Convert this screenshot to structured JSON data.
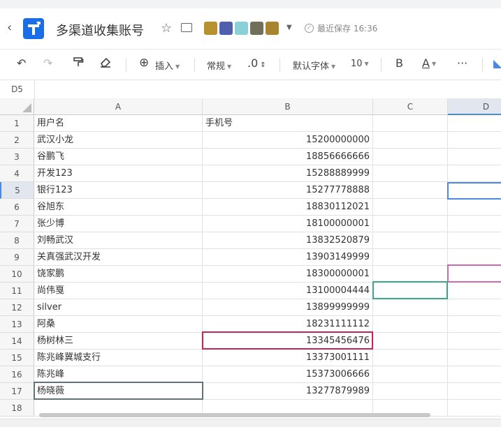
{
  "title_bar": {
    "doc_title": "多渠道收集账号",
    "save_status": "最近保存 16:36"
  },
  "toolbar": {
    "insert_label": "插入",
    "format_label": "常规",
    "decimal_label": ".0",
    "font_label": "默认字体",
    "size_label": "10",
    "bold_label": "B",
    "color_label": "A",
    "more_label": "···"
  },
  "formula_bar": {
    "cell_ref": "D5"
  },
  "sheet": {
    "columns": [
      "A",
      "B",
      "C",
      "D"
    ],
    "selected_column": "D",
    "selected_row": "5",
    "rows": [
      {
        "num": "1",
        "a": "用户名",
        "b": "手机号"
      },
      {
        "num": "2",
        "a": "武汉小龙",
        "b": "15200000000"
      },
      {
        "num": "3",
        "a": "谷鹏飞",
        "b": "18856666666"
      },
      {
        "num": "4",
        "a": "开发123",
        "b": "15288889999"
      },
      {
        "num": "5",
        "a": "银行123",
        "b": "15277778888"
      },
      {
        "num": "6",
        "a": "谷旭东",
        "b": "18830112021"
      },
      {
        "num": "7",
        "a": "张少博",
        "b": "18100000001"
      },
      {
        "num": "8",
        "a": "刘畅武汉",
        "b": "13832520879"
      },
      {
        "num": "9",
        "a": "关真强武汉开发",
        "b": "13903149999"
      },
      {
        "num": "10",
        "a": "饶家鹏",
        "b": "18300000001"
      },
      {
        "num": "11",
        "a": "尚伟戛",
        "b": "13100004444"
      },
      {
        "num": "12",
        "a": "silver",
        "b": "13899999999"
      },
      {
        "num": "13",
        "a": "阿桑",
        "b": "18231111112"
      },
      {
        "num": "14",
        "a": "杨树林三",
        "b": "13345456476"
      },
      {
        "num": "15",
        "a": "陈兆峰冀城支行",
        "b": "13373001111"
      },
      {
        "num": "16",
        "a": "陈兆峰",
        "b": "15373006666"
      },
      {
        "num": "17",
        "a": "杨晓薇",
        "b": "13277879989"
      },
      {
        "num": "18",
        "a": "",
        "b": ""
      }
    ]
  },
  "colors": {
    "selection_blue": "#4a89dc",
    "collab_pink": "#c86bb0",
    "collab_green": "#3aa882",
    "collab_red": "#c4245a",
    "collab_slate": "#5d7478"
  }
}
